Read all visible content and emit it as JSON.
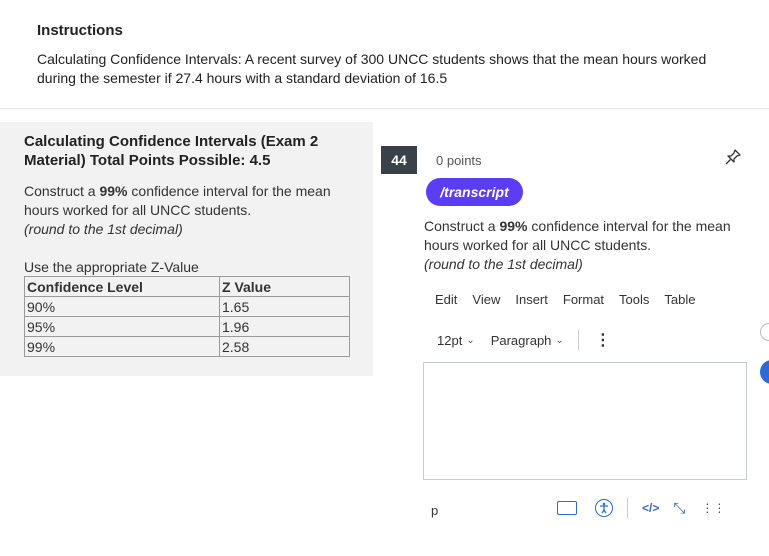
{
  "instructions": {
    "title": "Instructions",
    "body": "Calculating Confidence Intervals: A recent survey of 300 UNCC students shows that the mean hours worked during the semester if 27.4 hours with a standard deviation of 16.5"
  },
  "left_panel": {
    "title": "Calculating Confidence Intervals (Exam 2 Material) Total Points Possible: 4.5",
    "question_pre": "Construct a ",
    "question_bold": "99%",
    "question_post": " confidence interval for the mean hours worked for all UNCC students.",
    "question_note": "(round to the 1st decimal)",
    "z_caption": "Use the appropriate Z-Value",
    "z_table": {
      "headers": [
        "Confidence Level",
        "Z Value"
      ],
      "rows": [
        [
          "90%",
          "1.65"
        ],
        [
          "95%",
          "1.96"
        ],
        [
          "99%",
          "2.58"
        ]
      ]
    }
  },
  "question": {
    "number": "44",
    "points": "0 points",
    "transcript_label": "/transcript",
    "text_pre": "Construct a ",
    "text_bold": "99%",
    "text_post": " confidence interval for the mean hours worked for all UNCC students.",
    "text_note": "(round to the 1st decimal)"
  },
  "editor": {
    "menu": [
      "Edit",
      "View",
      "Insert",
      "Format",
      "Tools",
      "Table"
    ],
    "font_size": "12pt",
    "block_format": "Paragraph",
    "status_path": "p",
    "html_label": "</>"
  },
  "colors": {
    "accent": "#2d6ad1",
    "transcript": "#5b3df5",
    "badge": "#3a4149"
  }
}
